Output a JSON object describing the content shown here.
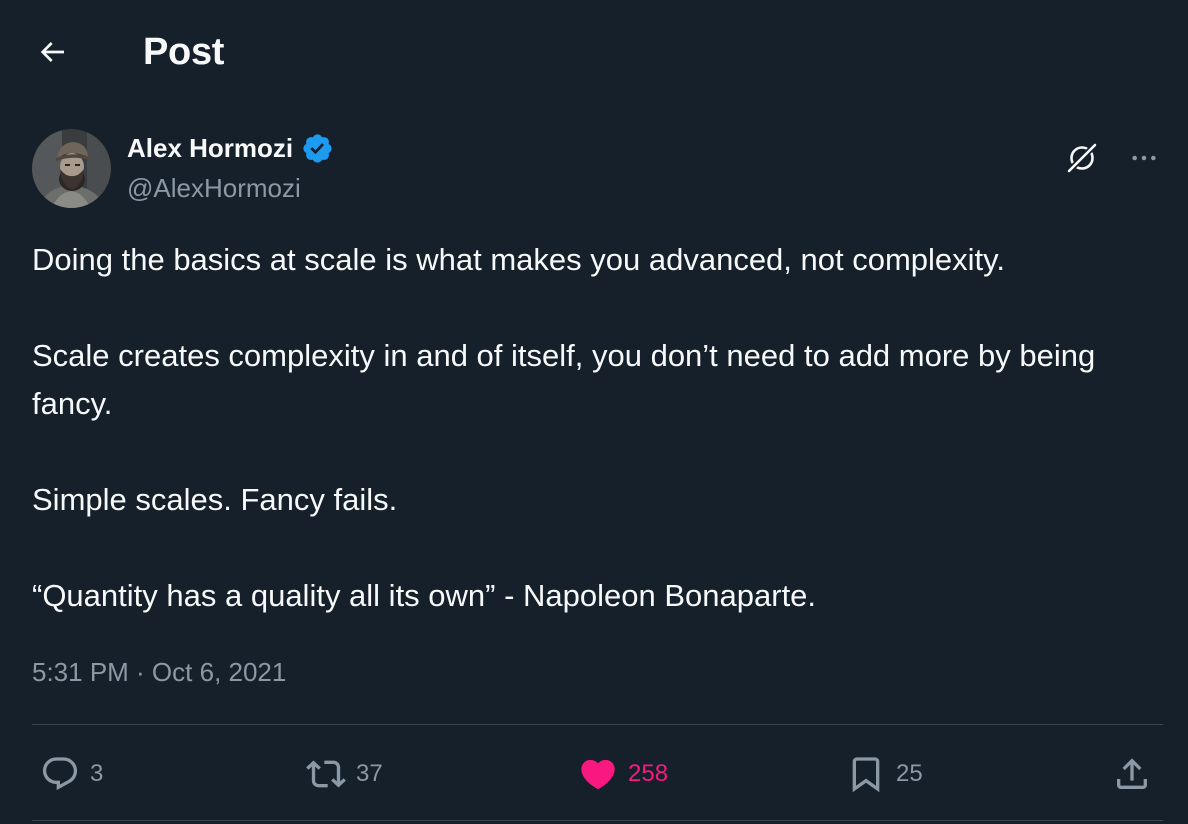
{
  "header": {
    "title": "Post",
    "back_icon": "arrow-left-icon"
  },
  "author": {
    "name": "Alex Hormozi",
    "handle": "@AlexHormozi",
    "verified": true,
    "verified_color": "#1d9bf0"
  },
  "tweet": {
    "paragraphs": [
      "Doing the basics at scale is what makes you advanced, not complexity.",
      "Scale creates complexity in and of itself, you don’t need to add more by being fancy.",
      "Simple scales. Fancy fails.",
      "“Quantity has a quality all its own” - Napoleon Bonaparte."
    ],
    "timestamp": "5:31 PM · Oct 6, 2021"
  },
  "actions": {
    "replies": "3",
    "reposts": "37",
    "likes": "258",
    "bookmarks": "25",
    "liked": true,
    "like_color": "#f91880"
  },
  "colors": {
    "background": "#15202b",
    "text_primary": "#f7f9f9",
    "text_secondary": "#8b98a5",
    "divider": "#38444d"
  }
}
